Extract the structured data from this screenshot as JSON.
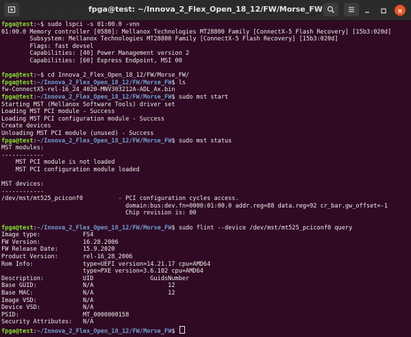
{
  "window": {
    "title": "fpga@test: ~/Innova_2_Flex_Open_18_12/FW/Morse_FW"
  },
  "icons": {
    "new_tab": "new-terminal-icon",
    "search": "search-icon",
    "menu": "hamburger-menu-icon",
    "minimize": "minimize-icon",
    "maximize": "maximize-icon",
    "close": "close-icon"
  },
  "colors": {
    "background": "#300a24",
    "text": "#eeeeec",
    "prompt_user": "#8ae234",
    "prompt_path": "#729fcf",
    "close_button": "#e95420"
  },
  "terminal": {
    "lines": [
      {
        "user": "fpga@test",
        "path": "~",
        "cmd": " sudo lspci -s 01:00.0 -vnn"
      },
      {
        "text": "01:00.0 Memory controller [0580]: Mellanox Technologies MT28800 Family [ConnectX-5 Flash Recovery] [15b3:020d]"
      },
      {
        "text": "        Subsystem: Mellanox Technologies MT28800 Family [ConnectX-5 Flash Recovery] [15b3:020d]"
      },
      {
        "text": "        Flags: fast devsel"
      },
      {
        "text": "        Capabilities: [40] Power Management version 2"
      },
      {
        "text": "        Capabilities: [60] Express Endpoint, MSI 00"
      },
      {
        "text": ""
      },
      {
        "user": "fpga@test",
        "path": "~",
        "cmd": " cd Innova_2_Flex_Open_18_12/FW/Morse_FW/"
      },
      {
        "user": "fpga@test",
        "path": "~/Innova_2_Flex_Open_18_12/FW/Morse_FW",
        "cmd": " ls"
      },
      {
        "text": "fw-ConnectX5-rel-16_24_4020-MNV303212A-ADL_Ax.bin"
      },
      {
        "user": "fpga@test",
        "path": "~/Innova_2_Flex_Open_18_12/FW/Morse_FW",
        "cmd": " sudo mst start"
      },
      {
        "text": "Starting MST (Mellanox Software Tools) driver set"
      },
      {
        "text": "Loading MST PCI module - Success"
      },
      {
        "text": "Loading MST PCI configuration module - Success"
      },
      {
        "text": "Create devices"
      },
      {
        "text": "Unloading MST PCI module (unused) - Success"
      },
      {
        "user": "fpga@test",
        "path": "~/Innova_2_Flex_Open_18_12/FW/Morse_FW",
        "cmd": " sudo mst status"
      },
      {
        "text": "MST modules:"
      },
      {
        "text": "------------"
      },
      {
        "text": "    MST PCI module is not loaded"
      },
      {
        "text": "    MST PCI configuration module loaded"
      },
      {
        "text": ""
      },
      {
        "text": "MST devices:"
      },
      {
        "text": "------------"
      },
      {
        "text": "/dev/mst/mt525_pciconf0          - PCI configuration cycles access."
      },
      {
        "text": "                                   domain:bus:dev.fn=0000:01:00.0 addr.reg=88 data.reg=92 cr_bar.gw_offset=-1"
      },
      {
        "text": "                                   Chip revision is: 00"
      },
      {
        "text": ""
      },
      {
        "user": "fpga@test",
        "path": "~/Innova_2_Flex_Open_18_12/FW/Morse_FW",
        "cmd": " sudo flint --device /dev/mst/mt525_pciconf0 query"
      },
      {
        "text": "Image type:            FS4"
      },
      {
        "text": "FW Version:            16.28.2006"
      },
      {
        "text": "FW Release Date:       15.9.2020"
      },
      {
        "text": "Product Version:       rel-16_28_2006"
      },
      {
        "text": "Rom Info:              type=UEFI version=14.21.17 cpu=AMD64"
      },
      {
        "text": "                       type=PXE version=3.6.102 cpu=AMD64"
      },
      {
        "text": "Description:           UID                GuidsNumber"
      },
      {
        "text": "Base GUID:             N/A                     12"
      },
      {
        "text": "Base MAC:              N/A                     12"
      },
      {
        "text": "Image VSD:             N/A"
      },
      {
        "text": "Device VSD:            N/A"
      },
      {
        "text": "PSID:                  MT_0000000158"
      },
      {
        "text": "Security Attributes:   N/A"
      },
      {
        "user": "fpga@test",
        "path": "~/Innova_2_Flex_Open_18_12/FW/Morse_FW",
        "cmd": " ",
        "cursor": true
      }
    ]
  }
}
